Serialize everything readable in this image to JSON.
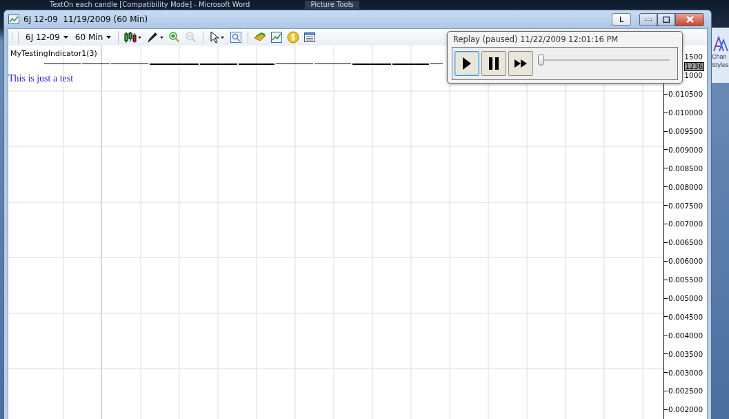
{
  "background_app": {
    "title": "TextOn each candle [Compatibility Mode] - Microsoft Word",
    "context_tab": "Picture Tools",
    "ribbon_texts": [
      "Chan",
      "Styles"
    ]
  },
  "window": {
    "title": "6J 12-09  11/19/2009 (60 Min)",
    "buttons": [
      "L"
    ]
  },
  "toolbar": {
    "instrument": "6J 12-09",
    "interval": "60 Min",
    "tools": [
      {
        "kind": "candles",
        "disabled": false
      },
      {
        "kind": "draw",
        "disabled": false
      },
      {
        "kind": "zoom-in",
        "disabled": false
      },
      {
        "kind": "zoom-out",
        "disabled": true
      },
      {
        "kind": "cursor",
        "disabled": false
      },
      {
        "kind": "zoom-box",
        "disabled": false
      },
      {
        "kind": "data",
        "disabled": false
      },
      {
        "kind": "chart",
        "disabled": false
      },
      {
        "kind": "coin",
        "disabled": false
      },
      {
        "kind": "table",
        "disabled": false
      }
    ]
  },
  "chart": {
    "indicator_label": "MyTestingIndicator1(3)",
    "note": "This is just a test",
    "price_axis": [
      {
        "label": "1500",
        "kind": "partial"
      },
      {
        "label": "1236",
        "kind": "current"
      },
      {
        "label": "1000",
        "kind": "partial"
      },
      {
        "label": "0.010500",
        "kind": "tick"
      },
      {
        "label": "0.010000",
        "kind": "tick"
      },
      {
        "label": "0.009500",
        "kind": "tick"
      },
      {
        "label": "0.009000",
        "kind": "tick"
      },
      {
        "label": "0.008500",
        "kind": "tick"
      },
      {
        "label": "0.008000",
        "kind": "tick"
      },
      {
        "label": "0.007500",
        "kind": "tick"
      },
      {
        "label": "0.007000",
        "kind": "tick"
      },
      {
        "label": "0.006500",
        "kind": "tick"
      },
      {
        "label": "0.006000",
        "kind": "tick"
      },
      {
        "label": "0.005500",
        "kind": "tick"
      },
      {
        "label": "0.005000",
        "kind": "tick"
      },
      {
        "label": "0.004500",
        "kind": "tick"
      },
      {
        "label": "0.004000",
        "kind": "tick"
      },
      {
        "label": "0.003500",
        "kind": "tick"
      },
      {
        "label": "0.003000",
        "kind": "tick"
      },
      {
        "label": "0.002500",
        "kind": "tick"
      },
      {
        "label": "0.002000",
        "kind": "tick"
      }
    ]
  },
  "replay": {
    "title": "Replay (paused) 11/22/2009 12:01:16 PM",
    "controls": [
      {
        "kind": "play",
        "selected": true
      },
      {
        "kind": "pause",
        "selected": false
      },
      {
        "kind": "fast-forward",
        "selected": false
      }
    ],
    "slider": {
      "level": 0
    }
  }
}
